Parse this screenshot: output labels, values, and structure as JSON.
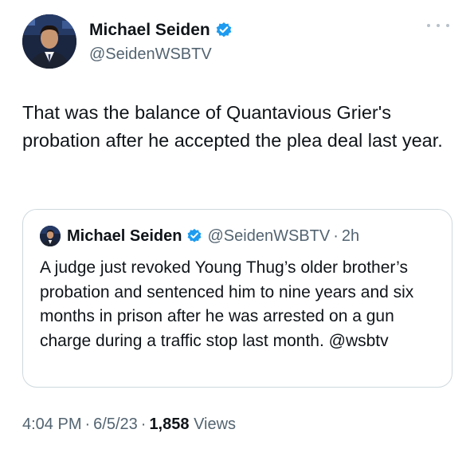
{
  "author": {
    "display_name": "Michael Seiden",
    "handle": "@SeidenWSBTV",
    "verified": true
  },
  "tweet_text": "That was the balance of Quantavious Grier's probation after he accepted the plea deal last year.",
  "quoted_tweet": {
    "display_name": "Michael Seiden",
    "handle": "@SeidenWSBTV",
    "separator": "·",
    "time_ago": "2h",
    "text": "A judge just revoked Young Thug’s older brother’s probation and sentenced him to nine years and six months in prison after he was arrested on a gun charge during a traffic stop last month. @wsbtv"
  },
  "meta": {
    "time": "4:04 PM",
    "separator": "·",
    "date": "6/5/23",
    "views_count": "1,858",
    "views_label": "Views"
  },
  "icons": {
    "verified": "verified-badge-icon",
    "more": "more-dots-icon"
  },
  "colors": {
    "verified_blue": "#1d9bf0",
    "secondary_text": "#536471",
    "border": "#cfd9de"
  }
}
